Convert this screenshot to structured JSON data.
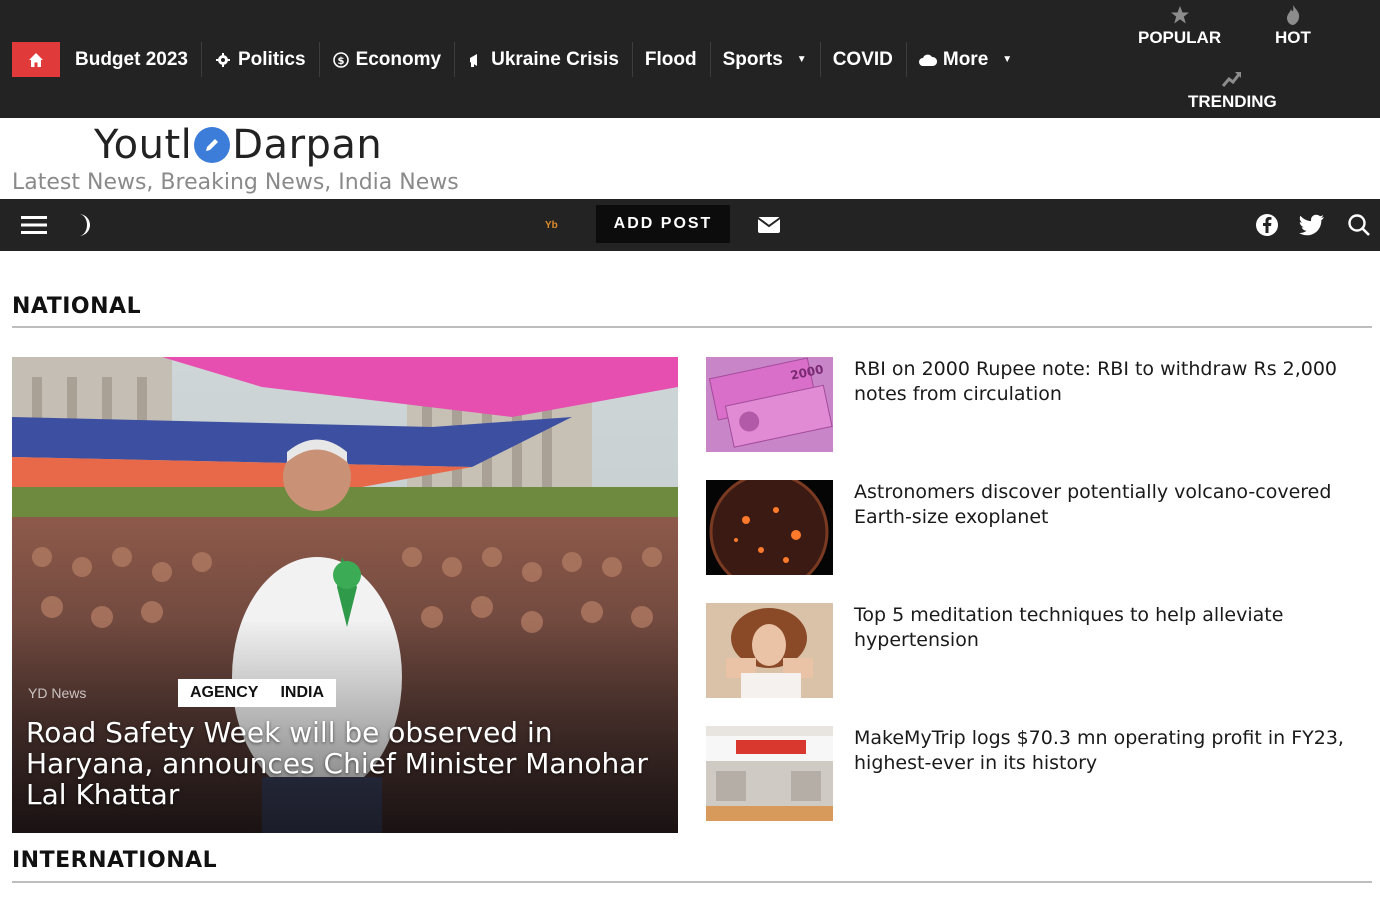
{
  "topbar": {
    "home_icon": "home-icon",
    "nav": [
      {
        "label": "Budget 2023",
        "icon": ""
      },
      {
        "label": "Politics",
        "icon": "gear-icon"
      },
      {
        "label": "Economy",
        "icon": "dollar-icon"
      },
      {
        "label": "Ukraine Crisis",
        "icon": "megaphone-icon"
      },
      {
        "label": "Flood",
        "icon": ""
      },
      {
        "label": "Sports",
        "icon": ""
      },
      {
        "label": "COVID",
        "icon": ""
      },
      {
        "label": "More",
        "icon": "cloud-icon"
      }
    ],
    "popular_label": "POPULAR",
    "hot_label": "HOT",
    "trending_label": "TRENDING"
  },
  "header": {
    "logo_left": "Youtl",
    "logo_right": "Darpan",
    "tagline": "Latest News, Breaking News, India News"
  },
  "toolbar": {
    "add_post_label": "ADD POST",
    "flag_text": "Yb"
  },
  "sections": {
    "national": "NATIONAL",
    "international": "INTERNATIONAL"
  },
  "featured": {
    "meta": "YD News",
    "tags": [
      "AGENCY",
      "INDIA"
    ],
    "title": "Road Safety Week will be observed in Haryana, announces Chief Minister Manohar Lal Khattar"
  },
  "side_news": [
    {
      "title": "RBI on 2000 Rupee note: RBI to withdraw Rs 2,000 notes from circulation"
    },
    {
      "title": "Astronomers discover potentially volcano-covered Earth-size exoplanet"
    },
    {
      "title": "Top 5 meditation techniques to help alleviate hypertension"
    },
    {
      "title": "MakeMyTrip logs $70.3 mn operating profit in FY23, highest-ever in its history"
    }
  ],
  "colors": {
    "dark_bar": "#232323",
    "home_red": "#e03a3a",
    "logo_blue": "#3b7dd8"
  }
}
